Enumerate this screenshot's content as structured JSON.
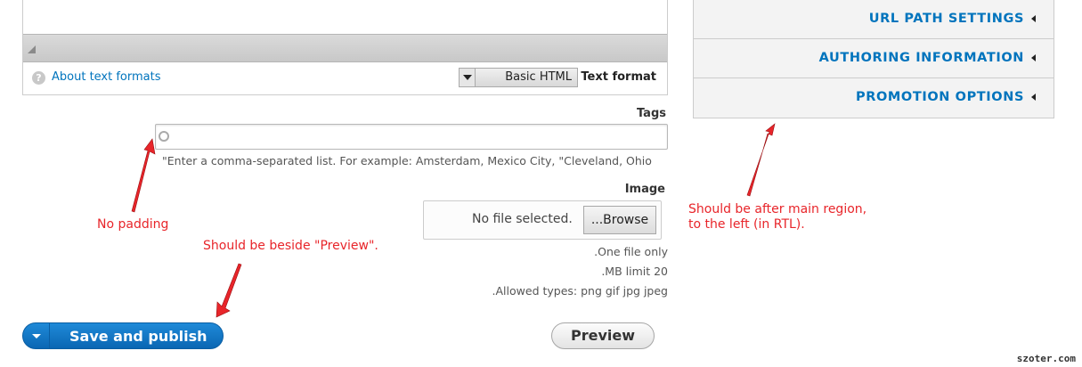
{
  "editor": {
    "about_link": "About text formats",
    "format_label": "Text format",
    "format_value": "Basic HTML"
  },
  "tags": {
    "label": "Tags",
    "value": "",
    "description": "\"Enter a comma-separated list. For example: Amsterdam, Mexico City, \"Cleveland, Ohio"
  },
  "image": {
    "label": "Image",
    "no_file": "No file selected.",
    "browse": "...Browse",
    "help": [
      ".One file only",
      ".MB limit 20",
      ".Allowed types: png gif jpg jpeg"
    ]
  },
  "actions": {
    "save": "Save and publish",
    "preview": "Preview"
  },
  "sidebar": {
    "items": [
      {
        "label": "URL PATH SETTINGS"
      },
      {
        "label": "AUTHORING INFORMATION"
      },
      {
        "label": "PROMOTION OPTIONS"
      }
    ]
  },
  "annotations": {
    "no_padding": "No padding",
    "beside_preview": "Should be beside \"Preview\".",
    "after_main_line1": "Should be after main region,",
    "after_main_line2": "to the left (in RTL)."
  },
  "watermark": "szoter.com",
  "colors": {
    "link": "#0074bd",
    "primary_button": "#0a66b3",
    "annotation": "#e8252a"
  }
}
